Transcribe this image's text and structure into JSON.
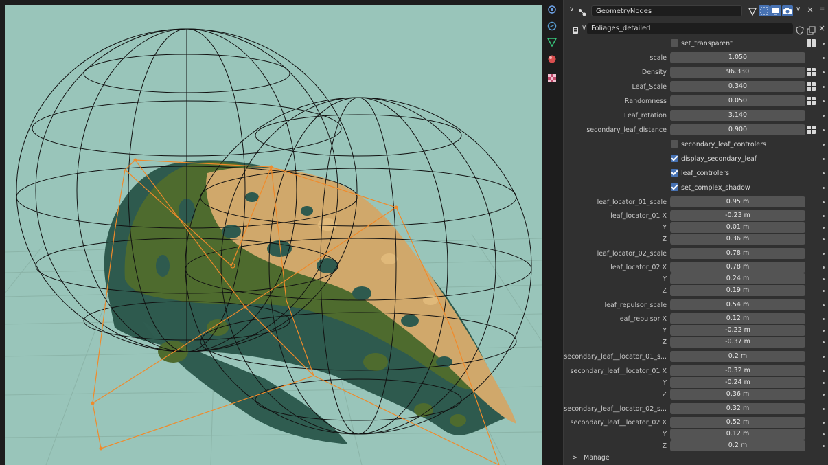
{
  "modifier": {
    "name": "GeometryNodes",
    "node_group": "Foliages_detailed"
  },
  "params": [
    {
      "kind": "check",
      "label": "set_transparent",
      "checked": false,
      "attr": true
    },
    {
      "kind": "value",
      "label": "scale",
      "value": "1.050",
      "attr": false
    },
    {
      "kind": "value",
      "label": "Density",
      "value": "96.330",
      "attr": true
    },
    {
      "kind": "value",
      "label": "Leaf_Scale",
      "value": "0.340",
      "attr": true
    },
    {
      "kind": "value",
      "label": "Randomness",
      "value": "0.050",
      "attr": true
    },
    {
      "kind": "value",
      "label": "Leaf_rotation",
      "value": "3.140",
      "attr": false
    },
    {
      "kind": "value",
      "label": "secondary_leaf_distance",
      "value": "0.900",
      "attr": true
    },
    {
      "kind": "check",
      "label": "secondary_leaf_controlers",
      "checked": false,
      "attr": false
    },
    {
      "kind": "check",
      "label": "display_secondary_leaf",
      "checked": true,
      "attr": false
    },
    {
      "kind": "check",
      "label": "leaf_controlers",
      "checked": true,
      "attr": false
    },
    {
      "kind": "check",
      "label": "set_complex_shadow",
      "checked": true,
      "attr": false
    },
    {
      "kind": "value",
      "label": "leaf_locator_01_scale",
      "value": "0.95 m",
      "attr": false
    },
    {
      "kind": "value",
      "label": "leaf_locator_01 X",
      "value": "-0.23 m",
      "attr": false
    },
    {
      "kind": "value",
      "label": "Y",
      "value": "0.01 m",
      "attr": false
    },
    {
      "kind": "value",
      "label": "Z",
      "value": "0.36 m",
      "attr": false
    },
    {
      "kind": "value",
      "label": "leaf_locator_02_scale",
      "value": "0.78 m",
      "attr": false
    },
    {
      "kind": "value",
      "label": "leaf_locator_02 X",
      "value": "0.78 m",
      "attr": false
    },
    {
      "kind": "value",
      "label": "Y",
      "value": "0.24 m",
      "attr": false
    },
    {
      "kind": "value",
      "label": "Z",
      "value": "0.19 m",
      "attr": false
    },
    {
      "kind": "value",
      "label": "leaf_repulsor_scale",
      "value": "0.54 m",
      "attr": false
    },
    {
      "kind": "value",
      "label": "leaf_repulsor X",
      "value": "0.12 m",
      "attr": false
    },
    {
      "kind": "value",
      "label": "Y",
      "value": "-0.22 m",
      "attr": false
    },
    {
      "kind": "value",
      "label": "Z",
      "value": "-0.37 m",
      "attr": false
    },
    {
      "kind": "value",
      "label": "secondary_leaf__locator_01_s...",
      "value": "0.2 m",
      "attr": false
    },
    {
      "kind": "value",
      "label": "secondary_leaf__locator_01 X",
      "value": "-0.32 m",
      "attr": false
    },
    {
      "kind": "value",
      "label": "Y",
      "value": "-0.24 m",
      "attr": false
    },
    {
      "kind": "value",
      "label": "Z",
      "value": "0.36 m",
      "attr": false
    },
    {
      "kind": "value",
      "label": "secondary_leaf__locator_02_s...",
      "value": "0.32 m",
      "attr": false
    },
    {
      "kind": "value",
      "label": "secondary_leaf__locator_02 X",
      "value": "0.52 m",
      "attr": false
    },
    {
      "kind": "value",
      "label": "Y",
      "value": "0.12 m",
      "attr": false
    },
    {
      "kind": "value",
      "label": "Z",
      "value": "0.2 m",
      "attr": false
    }
  ],
  "manage_label": "Manage",
  "icons": {
    "tools": [
      "scene-icon",
      "world-icon",
      "modifier-wrench-icon",
      "material-icon",
      "texture-icon"
    ],
    "header": [
      "node-tree-icon",
      "edit-mode-icon",
      "realtime-icon",
      "render-icon",
      "close-icon"
    ]
  },
  "colors": {
    "viewport_bg": "#99c5ba",
    "leaf_dark": "#2e5a4e",
    "leaf_green": "#4e6b2e",
    "leaf_tan": "#d0a86b",
    "locator_orange": "#f08a2a",
    "accent": "#4772b3"
  }
}
